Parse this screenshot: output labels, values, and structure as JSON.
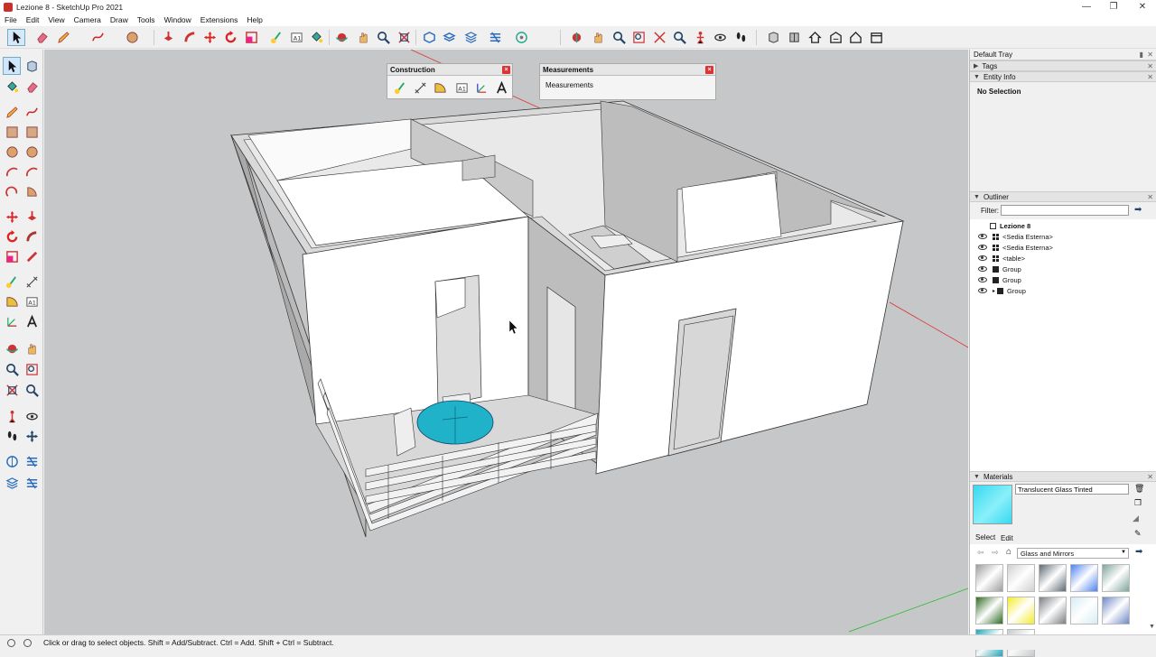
{
  "window": {
    "title": "Lezione 8 - SketchUp Pro 2021"
  },
  "menu": [
    "File",
    "Edit",
    "View",
    "Camera",
    "Draw",
    "Tools",
    "Window",
    "Extensions",
    "Help"
  ],
  "panels": {
    "construction": {
      "title": "Construction"
    },
    "measurements": {
      "title": "Measurements",
      "label": "Measurements"
    }
  },
  "tray": {
    "title": "Default Tray",
    "tags": "Tags",
    "entity_info": {
      "title": "Entity Info",
      "selection": "No Selection"
    },
    "outliner": {
      "title": "Outliner",
      "filter_label": "Filter:",
      "filter_value": "",
      "root": "Lezione 8",
      "items": [
        "<Sedia Esterna>",
        "<Sedia Esterna>",
        "<table>",
        "Group",
        "Group",
        "Group"
      ]
    },
    "materials": {
      "title": "Materials",
      "current": "Translucent Glass Tinted",
      "current_color": "#35d9f0",
      "tab_select": "Select",
      "tab_edit": "Edit",
      "collection": "Glass and Mirrors",
      "swatch_colors": [
        "#9d9d9d",
        "#d0d0d0",
        "#5f6a72",
        "#4f82f0",
        "#7fa49a",
        "#2f6b22",
        "#f4ec2a",
        "#7b7e83",
        "#d5ecf3",
        "#6f88c8",
        "#1aa7ba",
        "#c6c9cc"
      ]
    }
  },
  "status": {
    "message": "Click or drag to select objects. Shift = Add/Subtract. Ctrl = Add. Shift + Ctrl = Subtract."
  },
  "icons": [
    "select-arrow-icon",
    "eraser-icon",
    "pencil-icon",
    "paint-bucket-icon",
    "move-icon",
    "rotate-icon",
    "scale-icon",
    "tape-measure-icon",
    "orbit-icon",
    "pan-icon",
    "zoom-icon",
    "zoom-extents-icon",
    "eye-icon",
    "walk-icon",
    "section-plane-icon",
    "warehouse-icon"
  ]
}
